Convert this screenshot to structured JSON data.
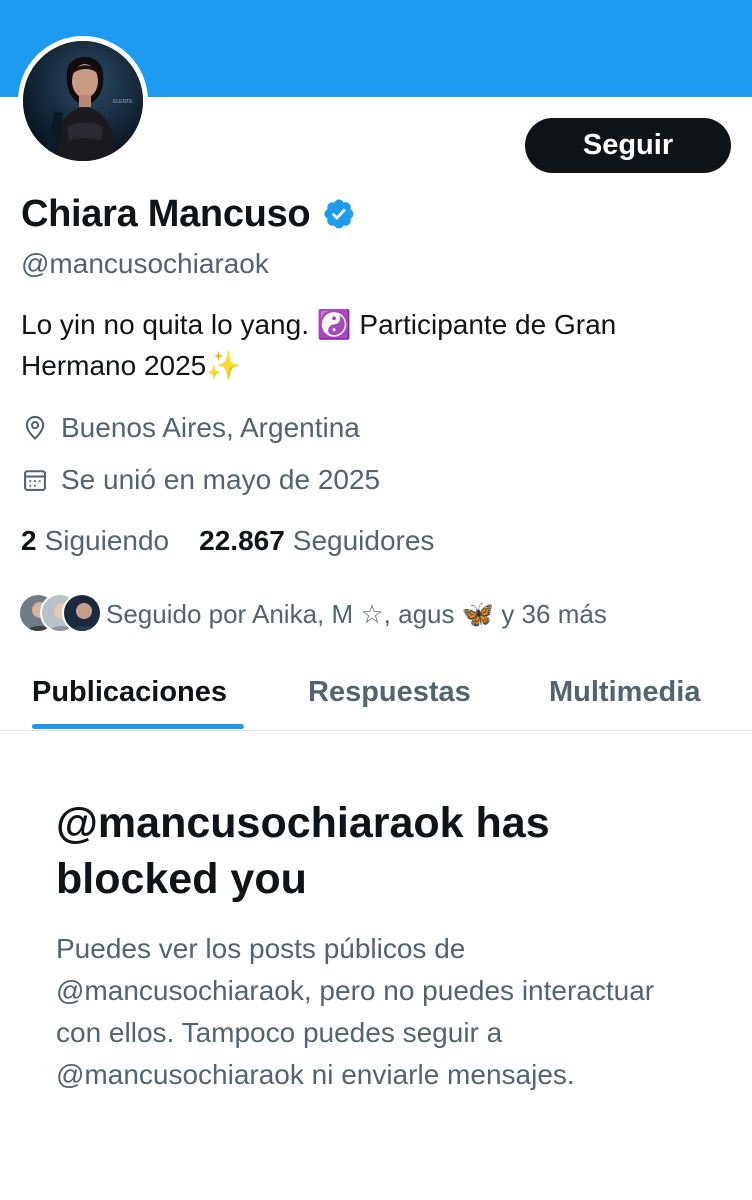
{
  "profile": {
    "display_name": "Chiara Mancuso",
    "handle": "@mancusochiaraok",
    "bio_line1": "Lo yin no quita lo yang.  ☯️ Participante de Gran",
    "bio_line2": "Hermano 2025✨",
    "location": "Buenos Aires, Argentina",
    "joined": "Se unió en mayo de 2025",
    "verified": true,
    "avatar_overlay_text": "ELENTE"
  },
  "actions": {
    "follow_label": "Seguir"
  },
  "stats": {
    "following_count": "2",
    "following_label": "Siguiendo",
    "followers_count": "22.867",
    "followers_label": "Seguidores"
  },
  "followed_by": {
    "text": "Seguido por Anika, M ☆, agus 🦋 y 36 más"
  },
  "tabs": [
    {
      "label": "Publicaciones",
      "active": true
    },
    {
      "label": "Respuestas",
      "active": false
    },
    {
      "label": "Multimedia",
      "active": false
    }
  ],
  "blocked": {
    "title": "@mancusochiaraok has blocked you",
    "message": "Puedes ver los posts públicos de @mancusochiaraok, pero no puedes interactuar con ellos. Tampoco puedes seguir a @mancusochiaraok ni enviarle mensajes."
  },
  "icons": {
    "location": "map-pin-icon",
    "joined": "calendar-icon",
    "verified": "verified-badge-icon"
  },
  "colors": {
    "accent": "#1d9bf0",
    "text_primary": "#0f1419",
    "text_secondary": "#536471",
    "button_bg": "#0f1419",
    "divider": "#dfe3e7"
  }
}
